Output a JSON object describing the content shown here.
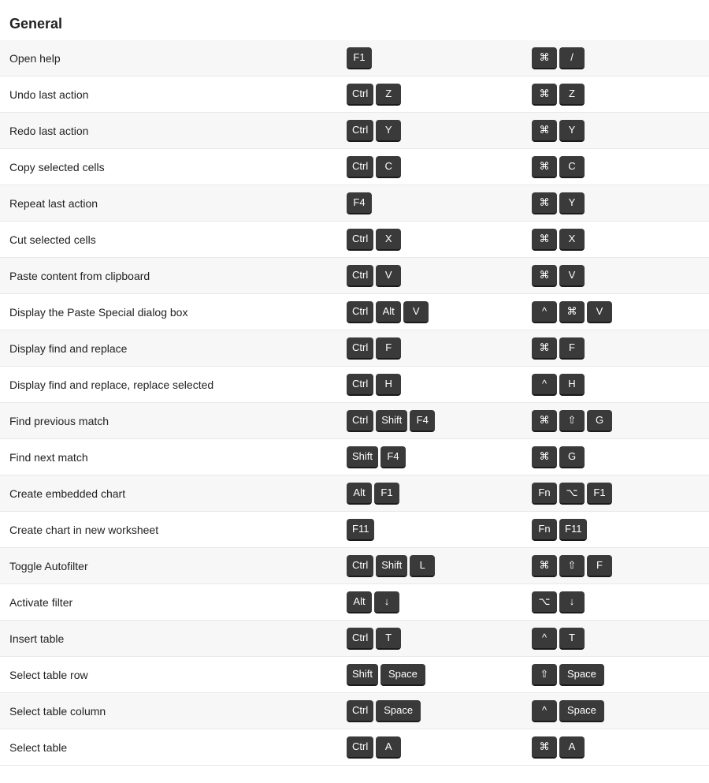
{
  "section": {
    "title": "General"
  },
  "rows": [
    {
      "action": "Open help",
      "win_keys": [
        "F1"
      ],
      "mac_keys": [
        "⌘",
        "/"
      ]
    },
    {
      "action": "Undo last action",
      "win_keys": [
        "Ctrl",
        "Z"
      ],
      "mac_keys": [
        "⌘",
        "Z"
      ]
    },
    {
      "action": "Redo last action",
      "win_keys": [
        "Ctrl",
        "Y"
      ],
      "mac_keys": [
        "⌘",
        "Y"
      ]
    },
    {
      "action": "Copy selected cells",
      "win_keys": [
        "Ctrl",
        "C"
      ],
      "mac_keys": [
        "⌘",
        "C"
      ]
    },
    {
      "action": "Repeat last action",
      "win_keys": [
        "F4"
      ],
      "mac_keys": [
        "⌘",
        "Y"
      ]
    },
    {
      "action": "Cut selected cells",
      "win_keys": [
        "Ctrl",
        "X"
      ],
      "mac_keys": [
        "⌘",
        "X"
      ]
    },
    {
      "action": "Paste content from clipboard",
      "win_keys": [
        "Ctrl",
        "V"
      ],
      "mac_keys": [
        "⌘",
        "V"
      ]
    },
    {
      "action": "Display the Paste Special dialog box",
      "win_keys": [
        "Ctrl",
        "Alt",
        "V"
      ],
      "mac_keys": [
        "^",
        "⌘",
        "V"
      ]
    },
    {
      "action": "Display find and replace",
      "win_keys": [
        "Ctrl",
        "F"
      ],
      "mac_keys": [
        "⌘",
        "F"
      ]
    },
    {
      "action": "Display find and replace, replace selected",
      "win_keys": [
        "Ctrl",
        "H"
      ],
      "mac_keys": [
        "^",
        "H"
      ]
    },
    {
      "action": "Find previous match",
      "win_keys": [
        "Ctrl",
        "Shift",
        "F4"
      ],
      "mac_keys": [
        "⌘",
        "⇧",
        "G"
      ]
    },
    {
      "action": "Find next match",
      "win_keys": [
        "Shift",
        "F4"
      ],
      "mac_keys": [
        "⌘",
        "G"
      ]
    },
    {
      "action": "Create embedded chart",
      "win_keys": [
        "Alt",
        "F1"
      ],
      "mac_keys": [
        "Fn",
        "⌥",
        "F1"
      ]
    },
    {
      "action": "Create chart in new worksheet",
      "win_keys": [
        "F11"
      ],
      "mac_keys": [
        "Fn",
        "F11"
      ]
    },
    {
      "action": "Toggle Autofilter",
      "win_keys": [
        "Ctrl",
        "Shift",
        "L"
      ],
      "mac_keys": [
        "⌘",
        "⇧",
        "F"
      ]
    },
    {
      "action": "Activate filter",
      "win_keys": [
        "Alt",
        "↓"
      ],
      "mac_keys": [
        "⌥",
        "↓"
      ]
    },
    {
      "action": "Insert table",
      "win_keys": [
        "Ctrl",
        "T"
      ],
      "mac_keys": [
        "^",
        "T"
      ]
    },
    {
      "action": "Select table row",
      "win_keys": [
        "Shift",
        "Space"
      ],
      "mac_keys": [
        "⇧",
        "Space"
      ]
    },
    {
      "action": "Select table column",
      "win_keys": [
        "Ctrl",
        "Space"
      ],
      "mac_keys": [
        "^",
        "Space"
      ]
    },
    {
      "action": "Select table",
      "win_keys": [
        "Ctrl",
        "A"
      ],
      "mac_keys": [
        "⌘",
        "A"
      ]
    }
  ]
}
